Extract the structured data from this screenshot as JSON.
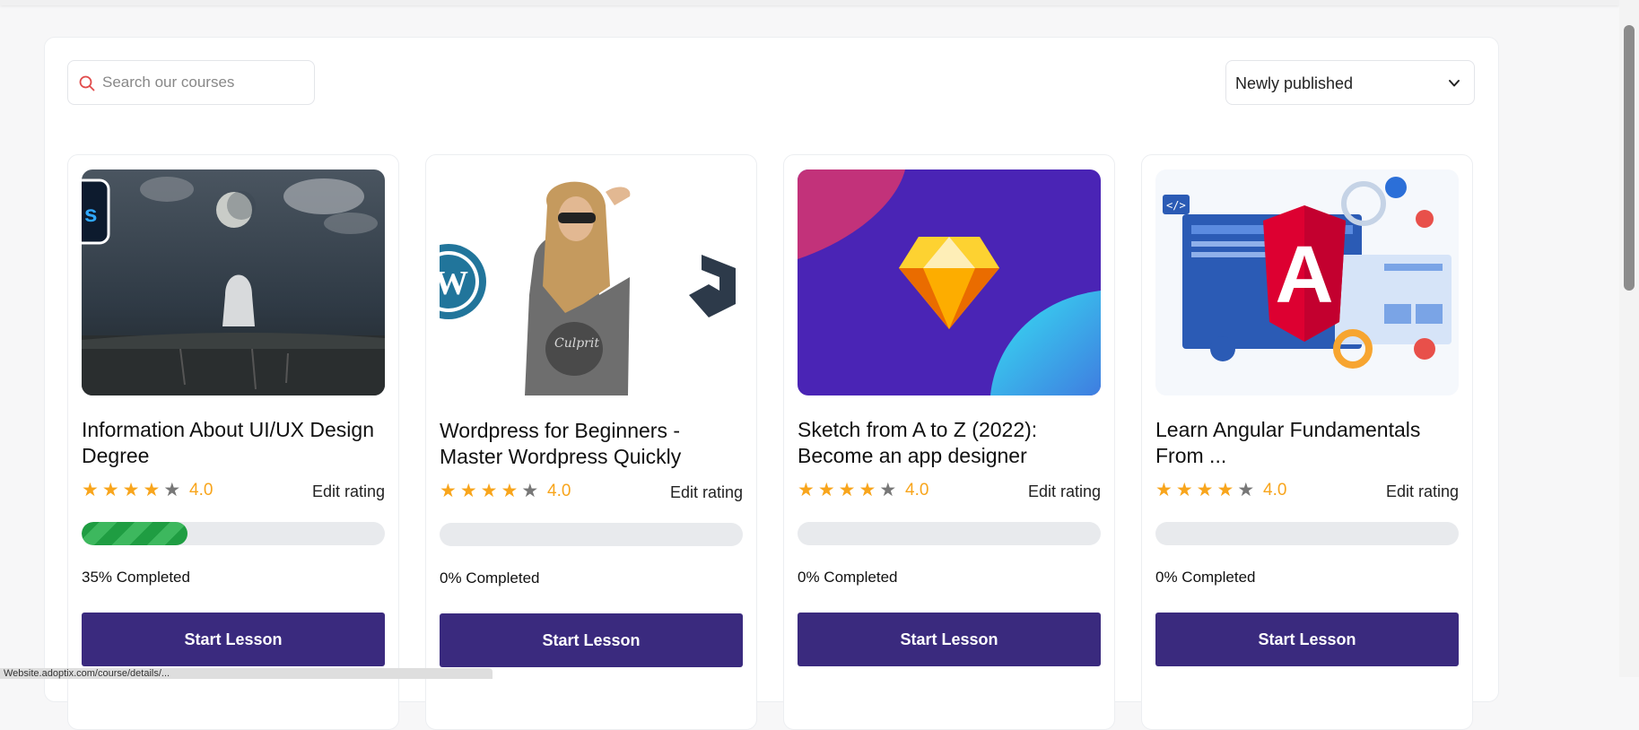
{
  "search": {
    "placeholder": "Search our courses"
  },
  "sort": {
    "selected": "Newly published"
  },
  "courses": [
    {
      "title": "Information About UI/UX Design Degree",
      "stars": "★★★★",
      "star_off": "★",
      "rating": "4.0",
      "edit": "Edit rating",
      "progress_value": 0.35,
      "progress": "35% Completed",
      "button": "Start Lesson"
    },
    {
      "title": "Wordpress for Beginners - Master Wordpress Quickly",
      "stars": "★★★★",
      "star_off": "★",
      "rating": "4.0",
      "edit": "Edit rating",
      "progress_value": 0,
      "progress": "0% Completed",
      "button": "Start Lesson"
    },
    {
      "title": "Sketch from A to Z (2022): Become an app designer",
      "stars": "★★★★",
      "star_off": "★",
      "rating": "4.0",
      "edit": "Edit rating",
      "progress_value": 0,
      "progress": "0% Completed",
      "button": "Start Lesson"
    },
    {
      "title": "Learn Angular Fundamentals From ...",
      "stars": "★★★★",
      "star_off": "★",
      "rating": "4.0",
      "edit": "Edit rating",
      "progress_value": 0,
      "progress": "0% Completed",
      "button": "Start Lesson"
    }
  ],
  "colors": {
    "accent": "#3a2a7e",
    "star": "#f8a51c",
    "progress": "#1f9d42"
  },
  "status_url": "Website.adoptix.com/course/details/..."
}
